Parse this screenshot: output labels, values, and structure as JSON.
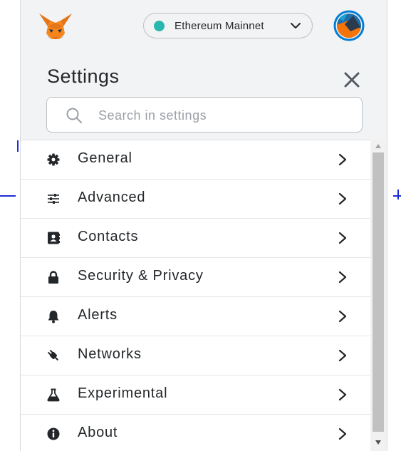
{
  "header": {
    "network": {
      "name": "Ethereum Mainnet",
      "dot_color": "#29b6af"
    },
    "logo_icon": "metamask-fox-icon",
    "avatar_icon": "account-identicon"
  },
  "settings": {
    "title": "Settings",
    "close_icon": "close-icon",
    "search": {
      "placeholder": "Search in settings",
      "value": "",
      "icon": "search-icon"
    }
  },
  "menu": {
    "items": [
      {
        "label": "General",
        "icon": "gear-icon"
      },
      {
        "label": "Advanced",
        "icon": "sliders-icon"
      },
      {
        "label": "Contacts",
        "icon": "contact-book-icon"
      },
      {
        "label": "Security & Privacy",
        "icon": "lock-icon"
      },
      {
        "label": "Alerts",
        "icon": "bell-icon"
      },
      {
        "label": "Networks",
        "icon": "plug-icon"
      },
      {
        "label": "Experimental",
        "icon": "flask-icon"
      },
      {
        "label": "About",
        "icon": "info-icon"
      }
    ],
    "chevron_icon": "chevron-right-icon"
  },
  "colors": {
    "accent": "#29b6af",
    "text": "#24272a",
    "panel_bg": "#f2f3f4",
    "background_line": "#1f2bd6"
  }
}
